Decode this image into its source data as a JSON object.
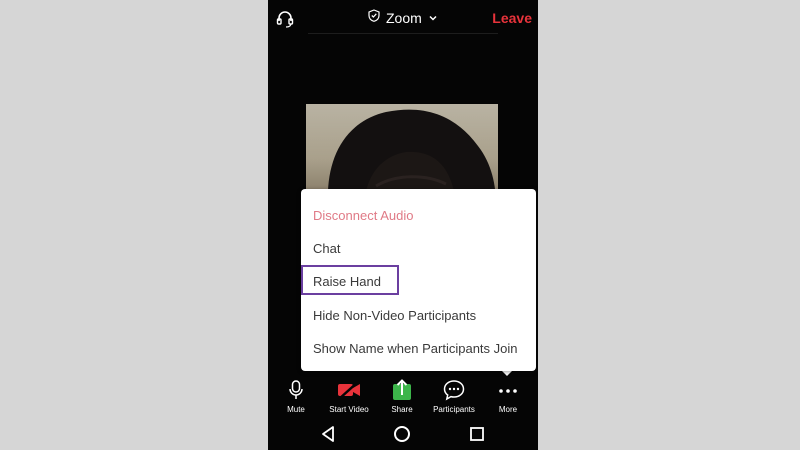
{
  "topbar": {
    "title": "Zoom",
    "leave_label": "Leave",
    "leave_color": "#e8333b",
    "icons": [
      "headset-icon",
      "shield-icon",
      "chevron-down-icon"
    ]
  },
  "menu": {
    "items": [
      {
        "label": "Disconnect Audio",
        "color": "#e07a86"
      },
      {
        "label": "Chat"
      },
      {
        "label": "Raise Hand",
        "highlighted": true
      },
      {
        "label": "Hide Non-Video Participants"
      },
      {
        "label": "Show Name when Participants Join"
      }
    ],
    "highlight_color": "#6b3fa0"
  },
  "toolbar": {
    "items": [
      {
        "label": "Mute",
        "icon": "microphone-icon"
      },
      {
        "label": "Start Video",
        "icon": "video-off-icon",
        "color": "#e8333b"
      },
      {
        "label": "Share",
        "icon": "share-icon",
        "color": "#3cb54a"
      },
      {
        "label": "Participants",
        "icon": "participants-icon"
      },
      {
        "label": "More",
        "icon": "more-icon"
      }
    ]
  },
  "navbar": {
    "icons": [
      "back-icon",
      "home-icon",
      "recents-icon"
    ]
  }
}
